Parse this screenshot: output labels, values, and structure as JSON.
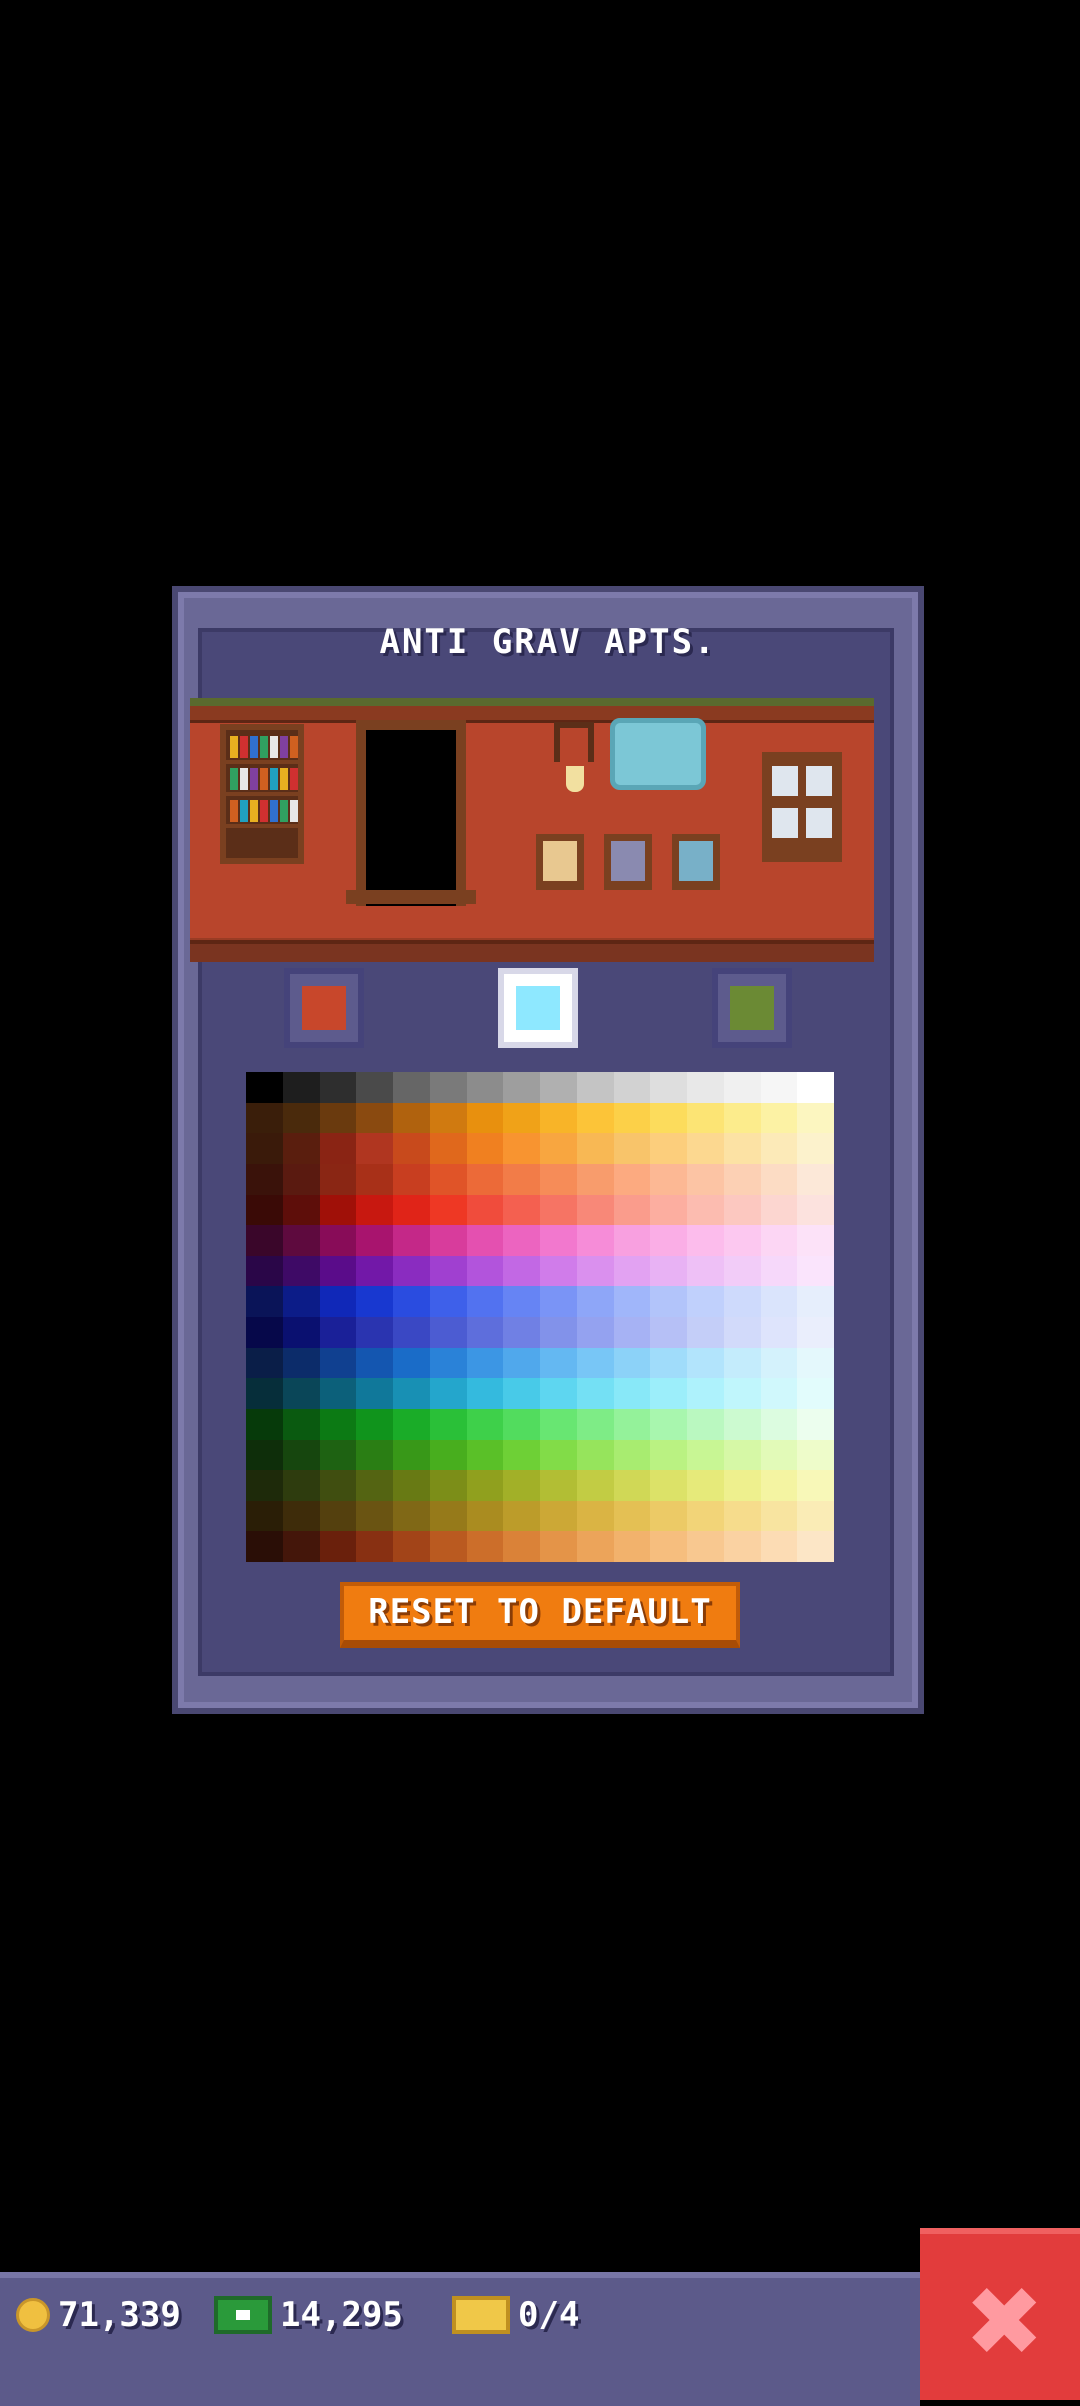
{
  "dialog": {
    "title": "ANTI GRAV APTS.",
    "colors": {
      "wall": "#c8472b",
      "accent": "#8ee8ff",
      "trim": "#6b8a34"
    },
    "reset_label": "RESET TO DEFAULT"
  },
  "palette": [
    [
      "#000000",
      "#1e1e1e",
      "#2e2e2e",
      "#4a4a4a",
      "#666666",
      "#7a7a7a",
      "#8c8c8c",
      "#9e9e9e",
      "#b0b0b0",
      "#c4c4c4",
      "#d2d2d2",
      "#dedede",
      "#e8e8e8",
      "#f0f0f0",
      "#f6f6f6",
      "#ffffff"
    ],
    [
      "#3a1e0a",
      "#4a2a0c",
      "#6a3a0e",
      "#8a4a10",
      "#b0620e",
      "#d07a10",
      "#e8900e",
      "#f0a218",
      "#f8b428",
      "#fcc438",
      "#fcd048",
      "#fcdc5c",
      "#fce474",
      "#fcec8c",
      "#fcf2a4",
      "#fcf6c0"
    ],
    [
      "#3a1a0a",
      "#5a1e0e",
      "#8a2414",
      "#b03620",
      "#c84a1c",
      "#e0681c",
      "#f08020",
      "#f89430",
      "#f8a640",
      "#f8b854",
      "#f8c46a",
      "#fcce7c",
      "#fcd890",
      "#fce2a4",
      "#fceab8",
      "#fcf2cc"
    ],
    [
      "#3a120a",
      "#5a1a10",
      "#8a2614",
      "#a83018",
      "#c83e20",
      "#e05428",
      "#ec6a38",
      "#f27c48",
      "#f68c58",
      "#f89c6c",
      "#fcaa80",
      "#fcb894",
      "#fcc4a4",
      "#fcd0b4",
      "#fcdcc4",
      "#fce8d8"
    ],
    [
      "#3a0a06",
      "#5e0e0a",
      "#a01008",
      "#c81810",
      "#e02418",
      "#ee3824",
      "#f04c3c",
      "#f46050",
      "#f67464",
      "#f88878",
      "#fa9c8c",
      "#fcaea0",
      "#fcbcb0",
      "#fcc8c0",
      "#fcd6d0",
      "#fce2de"
    ],
    [
      "#3a062a",
      "#5e0a3e",
      "#880c58",
      "#a8146e",
      "#c42888",
      "#d83c9c",
      "#e450b0",
      "#ec64c0",
      "#f278ce",
      "#f68cd8",
      "#f8a0e0",
      "#faaee6",
      "#fcbcec",
      "#fcc8f0",
      "#fcd6f4",
      "#fce2f8"
    ],
    [
      "#2a0648",
      "#3e0a66",
      "#5a0c8a",
      "#7218a8",
      "#8a2cc0",
      "#a040d0",
      "#b254dc",
      "#c268e4",
      "#d07cea",
      "#da90ee",
      "#e2a2f2",
      "#e8b2f4",
      "#eec0f6",
      "#f2ccf8",
      "#f6d8fa",
      "#fae4fc"
    ],
    [
      "#0a1458",
      "#0c1c88",
      "#1028b8",
      "#1838d0",
      "#2a4ce0",
      "#3e60ea",
      "#5272f0",
      "#6684f4",
      "#7a94f6",
      "#8ea6f8",
      "#a0b6fa",
      "#b2c4fa",
      "#c0d0fc",
      "#cedafc",
      "#dae4fc",
      "#e6eefc"
    ],
    [
      "#06084a",
      "#0a1070",
      "#1a2098",
      "#2a34b0",
      "#3a48c4",
      "#4c5cd2",
      "#5e6edc",
      "#7080e4",
      "#8292ea",
      "#94a2f0",
      "#a6b2f4",
      "#b6c0f6",
      "#c4cef8",
      "#d2dafa",
      "#dee4fc",
      "#eaeefc"
    ],
    [
      "#0a1e48",
      "#0c2c6a",
      "#104090",
      "#1456b0",
      "#1a6cc8",
      "#2a82d8",
      "#3c96e4",
      "#50a8ec",
      "#64b8f2",
      "#78c6f6",
      "#8cd2f8",
      "#a0dcfa",
      "#b2e4fc",
      "#c4ecfc",
      "#d4f2fc",
      "#e4f8fc"
    ],
    [
      "#062e3a",
      "#0a4658",
      "#0c607a",
      "#10789a",
      "#1890b4",
      "#24a6cc",
      "#34bade",
      "#48cae8",
      "#5ed6f0",
      "#74e0f4",
      "#88e8f8",
      "#9ceefa",
      "#aef2fc",
      "#c0f6fc",
      "#d0f8fc",
      "#e2fcfc"
    ],
    [
      "#063a0a",
      "#0a5a10",
      "#0c7a14",
      "#10941c",
      "#1aac28",
      "#2ac038",
      "#3ed04a",
      "#52dc5e",
      "#68e672",
      "#7eec86",
      "#94f29a",
      "#a8f6ae",
      "#baf8c0",
      "#ccfad0",
      "#dcfce0",
      "#ecfeee"
    ],
    [
      "#0e2e0a",
      "#16460e",
      "#1e6212",
      "#2a7e14",
      "#389818",
      "#48ae1e",
      "#5ac028",
      "#6ed036",
      "#82dc48",
      "#96e45c",
      "#a8ec70",
      "#baf282",
      "#c8f694",
      "#d6f8a6",
      "#e2fab8",
      "#eefcca"
    ],
    [
      "#1e2a0a",
      "#2e3c0e",
      "#404e10",
      "#546412",
      "#687a14",
      "#7c8e18",
      "#90a01e",
      "#a2b028",
      "#b2be34",
      "#c2cc44",
      "#d0d856",
      "#dce268",
      "#e6ea7a",
      "#eef08e",
      "#f4f4a2",
      "#f8f8b8"
    ],
    [
      "#2a1e06",
      "#3e2c0a",
      "#54400e",
      "#6a5412",
      "#806816",
      "#967a1a",
      "#aa8c20",
      "#bc9c2a",
      "#cca836",
      "#dab444",
      "#e4c054",
      "#ecca66",
      "#f2d478",
      "#f6dc8c",
      "#f8e4a0",
      "#faecb6"
    ],
    [
      "#2a0e06",
      "#44160a",
      "#6a200c",
      "#883012",
      "#a24418",
      "#ba5a20",
      "#cc6e2a",
      "#da8238",
      "#e49448",
      "#eca45a",
      "#f2b26c",
      "#f6be7e",
      "#f8c890",
      "#fad2a2",
      "#fcdcb4",
      "#fce6c6"
    ]
  ],
  "room": {
    "book_colors": [
      "#e8b020",
      "#d03030",
      "#3070d0",
      "#30a060",
      "#e8e8e8",
      "#8040a0",
      "#d06020",
      "#20a0c0"
    ]
  },
  "bottom_bar": {
    "coins": "71,339",
    "bux": "14,295",
    "tickets": "0/4"
  }
}
